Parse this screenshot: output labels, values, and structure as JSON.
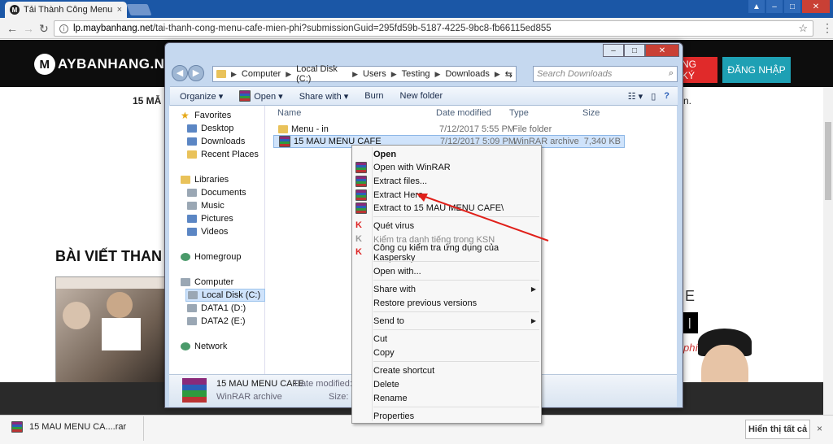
{
  "browser": {
    "tab_title": "Tải Thành Công Menu Ca",
    "tab_close": "×",
    "url_domain": "lp.maybanhang.net",
    "url_path": "/tai-thanh-cong-menu-cafe-mien-phi?submissionGuid=295fd59b-5187-4225-9bc8-fb66115ed855"
  },
  "site": {
    "logo_text": "AYBANHANG.NET",
    "logo_letter": "M",
    "register_label": "NG KÝ",
    "login_label": "ĐĂNG NHẬP",
    "intro_left": "15 MẪ",
    "intro_right": "n.",
    "heading": "BÀI VIẾT THAN",
    "ad_letter": "E",
    "ad_phi": "phí"
  },
  "explorer": {
    "breadcrumb": [
      "Computer",
      "Local Disk (C:)",
      "Users",
      "Testing",
      "Downloads"
    ],
    "search_placeholder": "Search Downloads",
    "commands": [
      "Organize ▾",
      "Open ▾",
      "Share with ▾",
      "Burn",
      "New folder"
    ],
    "nav": {
      "favorites": "Favorites",
      "desktop": "Desktop",
      "downloads": "Downloads",
      "recent": "Recent Places",
      "libraries": "Libraries",
      "documents": "Documents",
      "music": "Music",
      "pictures": "Pictures",
      "videos": "Videos",
      "homegroup": "Homegroup",
      "computer": "Computer",
      "local_disk": "Local Disk (C:)",
      "data1": "DATA1 (D:)",
      "data2": "DATA2 (E:)",
      "network": "Network"
    },
    "columns": [
      "Name",
      "Date modified",
      "Type",
      "Size"
    ],
    "files": [
      {
        "name": "Menu - in",
        "date": "7/12/2017 5:55 PM",
        "type": "File folder",
        "size": ""
      },
      {
        "name": "15 MAU MENU CAFE",
        "date": "7/12/2017 5:09 PM",
        "type": "WinRAR archive",
        "size": "7,340 KB"
      }
    ],
    "details": {
      "name": "15 MAU MENU CAFE",
      "modified_label": "Date modified: 7/",
      "type": "WinRAR archive",
      "size_label": "Size: 7."
    }
  },
  "context_menu": {
    "open": "Open",
    "open_winrar": "Open with WinRAR",
    "extract_files": "Extract files...",
    "extract_here": "Extract Here",
    "extract_to": "Extract to 15 MAU MENU CAFE\\",
    "scan": "Quét virus",
    "ksn": "Kiểm tra danh tiếng trong KSN",
    "kaspersky": "Công cụ kiểm tra ứng dụng của Kaspersky",
    "open_with": "Open with...",
    "share_with": "Share with",
    "restore": "Restore previous versions",
    "send_to": "Send to",
    "cut": "Cut",
    "copy": "Copy",
    "create_shortcut": "Create shortcut",
    "delete": "Delete",
    "rename": "Rename",
    "properties": "Properties"
  },
  "download_bar": {
    "file": "15 MAU MENU CA....rar",
    "show_all": "Hiển thị tất cả",
    "close": "×"
  },
  "colors": {
    "annotation_arrow": "#e0201a",
    "register_bg": "#e02a2a",
    "login_bg": "#1ea0b4"
  }
}
